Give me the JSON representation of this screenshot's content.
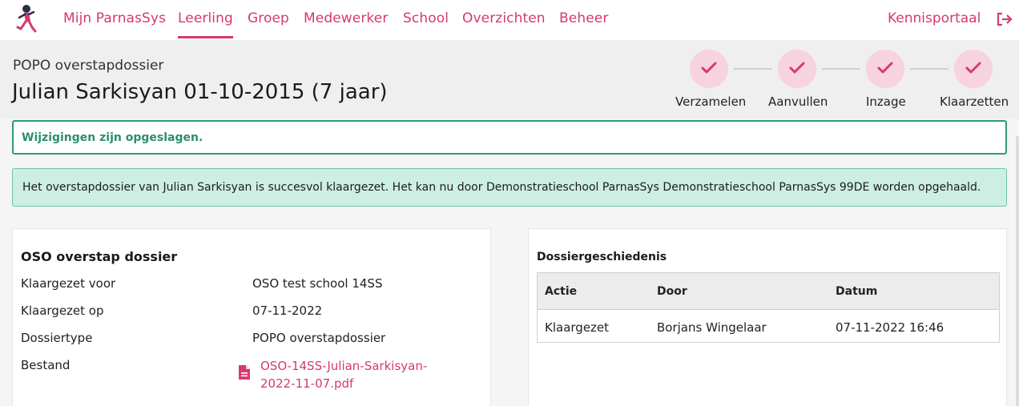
{
  "nav": {
    "items": [
      {
        "label": "Mijn ParnasSys",
        "active": false
      },
      {
        "label": "Leerling",
        "active": true
      },
      {
        "label": "Groep",
        "active": false
      },
      {
        "label": "Medewerker",
        "active": false
      },
      {
        "label": "School",
        "active": false
      },
      {
        "label": "Overzichten",
        "active": false
      },
      {
        "label": "Beheer",
        "active": false
      }
    ],
    "kennisportaal": "Kennisportaal",
    "logout_icon": "logout-icon",
    "accent_color": "#d63a6c"
  },
  "header": {
    "subtitle": "POPO overstapdossier",
    "title": "Julian Sarkisyan 01-10-2015 (7 jaar)"
  },
  "steps": [
    {
      "label": "Verzamelen",
      "done": true
    },
    {
      "label": "Aanvullen",
      "done": true
    },
    {
      "label": "Inzage",
      "done": true
    },
    {
      "label": "Klaarzetten",
      "done": true
    }
  ],
  "alerts": {
    "saved": "Wijzigingen zijn opgeslagen.",
    "success": "Het overstapdossier van Julian Sarkisyan is succesvol klaargezet. Het kan nu door Demonstratieschool ParnasSys Demonstratieschool ParnasSys 99DE worden opgehaald."
  },
  "oso": {
    "title": "OSO overstap dossier",
    "rows": [
      {
        "label": "Klaargezet voor",
        "value": "OSO test school 14SS"
      },
      {
        "label": "Klaargezet op",
        "value": "07-11-2022"
      },
      {
        "label": "Dossiertype",
        "value": "POPO overstapdossier"
      },
      {
        "label": "Bestand",
        "value": ""
      }
    ],
    "file": {
      "line1": "OSO-14SS-Julian-Sarkisyan-",
      "line2": "2022-11-07.pdf",
      "icon": "file-document-icon"
    }
  },
  "history": {
    "title": "Dossiergeschiedenis",
    "columns": [
      "Actie",
      "Door",
      "Datum"
    ],
    "rows": [
      [
        "Klaargezet",
        "Borjans Wingelaar",
        "07-11-2022 16:46"
      ]
    ]
  }
}
